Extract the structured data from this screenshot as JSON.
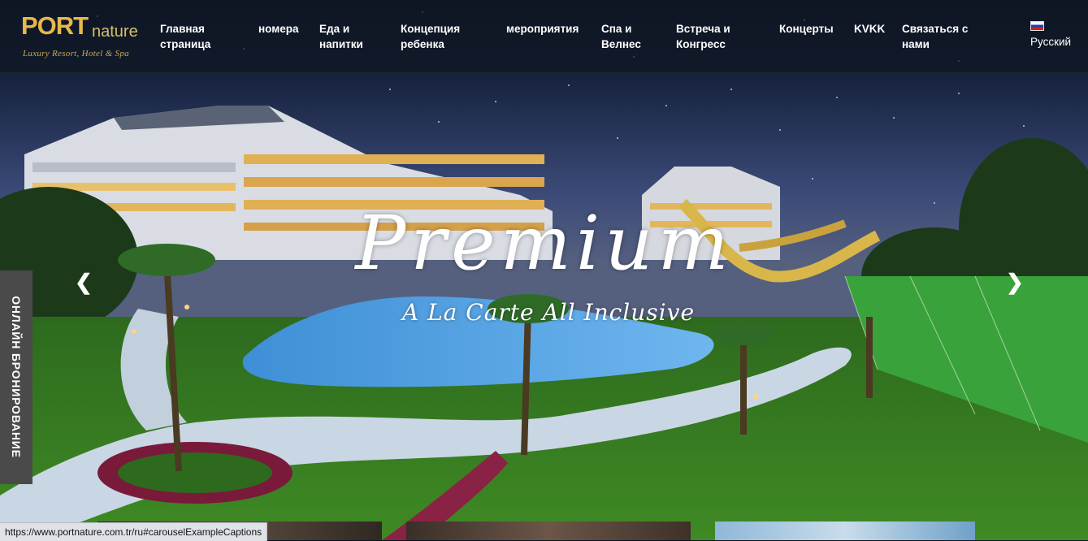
{
  "header": {
    "logo": {
      "word": "PORT",
      "suffix": "nature",
      "tagline": "Luxury Resort, Hotel & Spa"
    },
    "nav": [
      {
        "id": "home",
        "label": "Главная страница"
      },
      {
        "id": "rooms",
        "label": "номера"
      },
      {
        "id": "food",
        "label": "Еда и напитки"
      },
      {
        "id": "kids",
        "label": "Концепция ребенка"
      },
      {
        "id": "events",
        "label": "мероприятия"
      },
      {
        "id": "spa",
        "label": "Спа и Велнес"
      },
      {
        "id": "meeting",
        "label": "Встреча и Конгресс"
      },
      {
        "id": "concerts",
        "label": "Концерты"
      },
      {
        "id": "kvkk",
        "label": "KVKK"
      },
      {
        "id": "contact",
        "label": "Связаться с нами"
      }
    ],
    "language": {
      "label": "Русский",
      "flag_icon": "russia-flag-icon"
    }
  },
  "hero": {
    "title": "Premium",
    "subtitle": "A La Carte All Inclusive",
    "prev_icon": "chevron-left-icon",
    "next_icon": "chevron-right-icon"
  },
  "booking_tab": {
    "label": "ОНЛАЙН БРОНИРОВАНИЕ"
  },
  "status_bar": {
    "url": "https://www.portnature.com.tr/ru#carouselExampleCaptions"
  },
  "colors": {
    "header_bg": "#0e1624",
    "logo_gold": "#e6b84a",
    "booking_tab_bg": "#4a4a4a",
    "nav_text": "#ffffff"
  }
}
